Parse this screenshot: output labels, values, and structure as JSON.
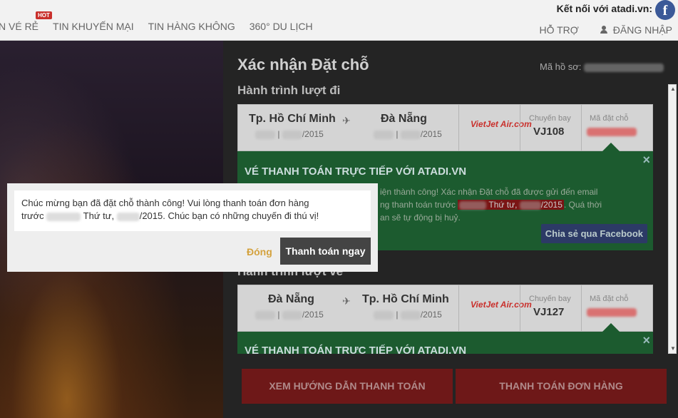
{
  "header": {
    "nav": [
      "N VÉ RẺ",
      "TIN KHUYẾN MẠI",
      "TIN HÀNG KHÔNG",
      "360° DU LỊCH"
    ],
    "hot_badge": "HOT",
    "connect_text": "Kết nối với atadi.vn:",
    "facebook_icon_glyph": "f",
    "support": "HỖ TRỢ",
    "login": "ĐĂNG NHẬP"
  },
  "booking": {
    "title": "Xác nhận Đặt chỗ",
    "record_label": "Mã hồ sơ:",
    "outbound_heading": "Hành trình lượt đi",
    "return_heading": "Hành trình lượt về",
    "outbound": {
      "from": "Tp. Hồ Chí Minh",
      "to": "Đà Nẵng",
      "from_date_suffix": "/2015",
      "to_date_suffix": "/2015",
      "separator": "|",
      "airline_logo": "VietJet Air.com",
      "flight_label": "Chuyến bay",
      "flight_no": "VJ108",
      "code_label": "Mã đặt chỗ"
    },
    "return": {
      "from": "Đà Nẵng",
      "to": "Tp. Hồ Chí Minh",
      "from_date_suffix": "/2015",
      "to_date_suffix": "/2015",
      "separator": "|",
      "airline_logo": "VietJet Air.com",
      "flight_label": "Chuyến bay",
      "flight_no": "VJ127",
      "code_label": "Mã đặt chỗ"
    },
    "notice": {
      "heading": "VÉ THANH TOÁN TRỰC TIẾP VỚI ATADI.VN",
      "line1": "iện thành công! Xác nhận Đặt chỗ đã được gửi đến email",
      "line2_prefix": "ng thanh toán trước",
      "line2_highlight": " Thứ tư, ",
      "line2_suffix": "/2015",
      "line2_end": ". Quá thời",
      "line3": "an sẽ tự động bị huỷ.",
      "share": "Chia sẻ qua Facebook",
      "close": "×"
    },
    "buttons": {
      "guide": "XEM HƯỚNG DẪN THANH TOÁN",
      "pay": "THANH TOÁN ĐƠN HÀNG"
    }
  },
  "modal": {
    "line1": "Chúc mừng bạn đã đặt chỗ thành công! Vui lòng thanh toán đơn hàng",
    "line2_prefix": "trước",
    "line2_mid": " Thứ tư, ",
    "line2_suffix": "/2015. Chúc bạn có những chuyến đi thú vị!",
    "close_label": "Đóng",
    "pay_label": "Thanh toán ngay"
  },
  "colors": {
    "accent_red": "#c9302c",
    "notice_green": "#1c5b2f",
    "facebook_blue": "#3b5998",
    "close_gold": "#d4a23e"
  }
}
